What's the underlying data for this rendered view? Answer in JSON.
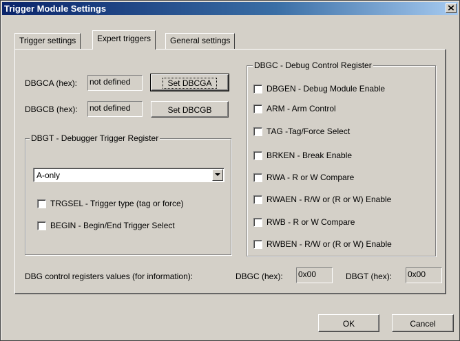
{
  "window": {
    "title": "Trigger Module Settings"
  },
  "tabs": [
    {
      "label": "Trigger settings"
    },
    {
      "label": "Expert triggers"
    },
    {
      "label": "General settings"
    }
  ],
  "dbgca": {
    "label": "DBGCA (hex):",
    "value": "not defined",
    "button": "Set DBCGA"
  },
  "dbgcb": {
    "label": "DBGCB (hex):",
    "value": "not defined",
    "button": "Set DBCGB"
  },
  "dbgt": {
    "title": "DBGT - Debugger Trigger Register",
    "select_value": "A-only",
    "checks": [
      {
        "label": "TRGSEL - Trigger type (tag or force)",
        "checked": false
      },
      {
        "label": "BEGIN - Begin/End Trigger Select",
        "checked": false
      }
    ]
  },
  "dbgc": {
    "title": "DBGC - Debug Control Register",
    "checks": [
      {
        "label": "DBGEN - Debug Module Enable",
        "checked": false
      },
      {
        "label": "ARM - Arm Control",
        "checked": false
      },
      {
        "label": "TAG -Tag/Force Select",
        "checked": false
      },
      {
        "label": "BRKEN - Break Enable",
        "checked": false
      },
      {
        "label": "RWA - R or W Compare",
        "checked": false
      },
      {
        "label": "RWAEN - R/W or (R or W) Enable",
        "checked": false
      },
      {
        "label": "RWB - R or W Compare",
        "checked": false
      },
      {
        "label": "RWBEN - R/W or (R or W) Enable",
        "checked": false
      }
    ]
  },
  "info": {
    "label": "DBG control registers values (for information):",
    "dbgc_label": "DBGC (hex):",
    "dbgc_value": "0x00",
    "dbgt_label": "DBGT (hex):",
    "dbgt_value": "0x00"
  },
  "footer": {
    "ok": "OK",
    "cancel": "Cancel"
  }
}
